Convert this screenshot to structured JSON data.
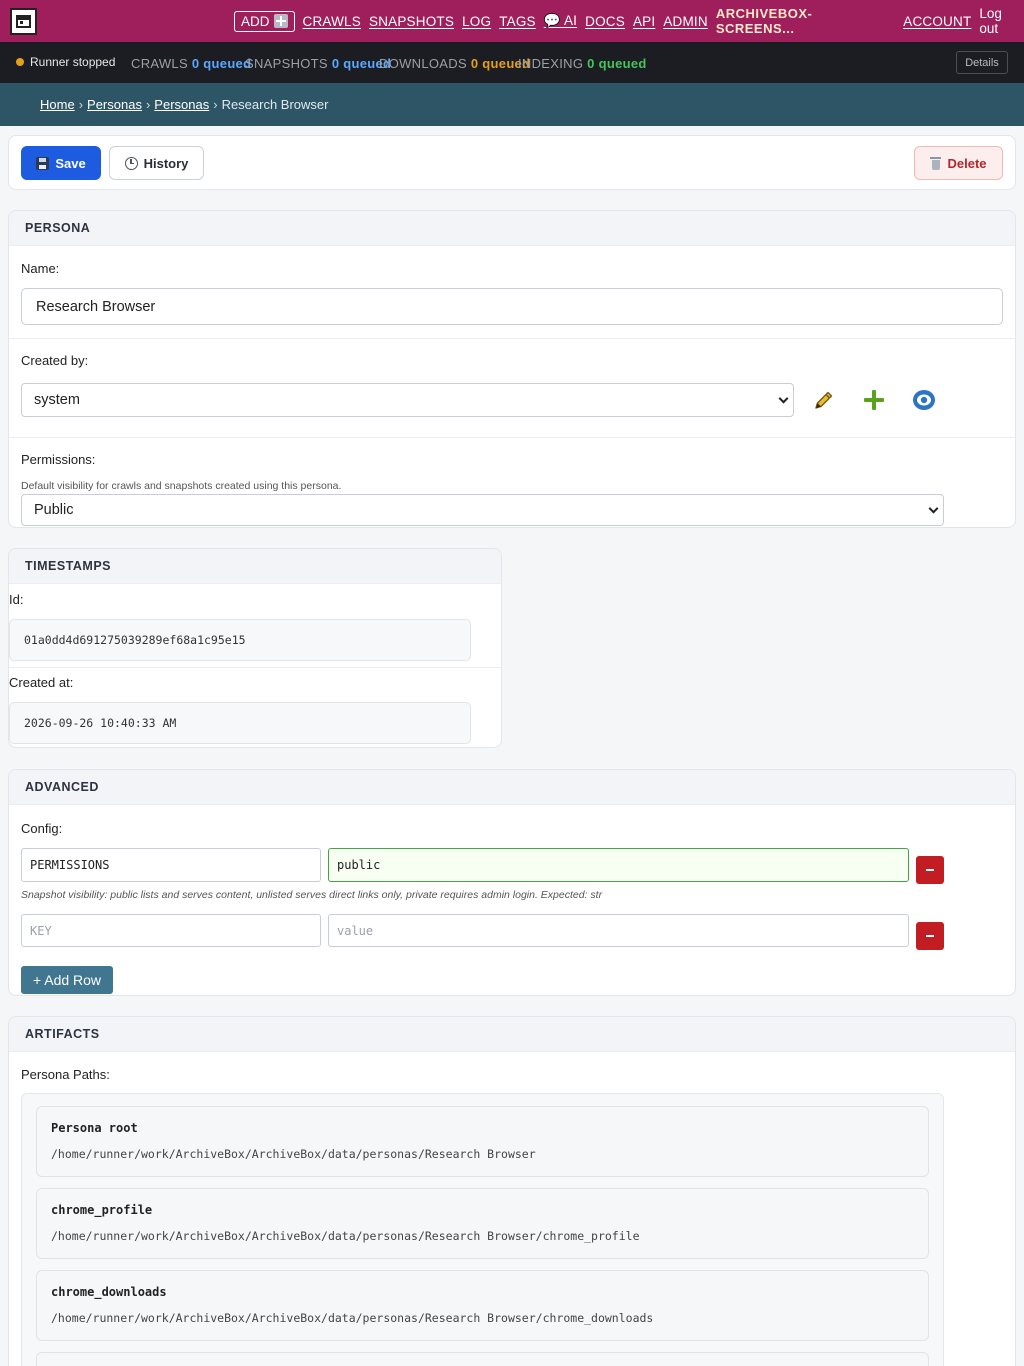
{
  "nav": {
    "add_label": "ADD",
    "links": [
      "CRAWLS",
      "SNAPSHOTS",
      "LOG",
      "TAGS",
      "💬 AI",
      "DOCS",
      "API",
      "ADMIN"
    ],
    "brand": "ARCHIVEBOX-SCREENS...",
    "account": "ACCOUNT",
    "logout": "Log out"
  },
  "status": {
    "runner": "Runner stopped",
    "crawls_label": "CRAWLS",
    "crawls_value": "0 queued",
    "snapshots_label": "SNAPSHOTS",
    "snapshots_value": "0 queued",
    "downloads_label": "DOWNLOADS",
    "downloads_value": "0 queued",
    "indexing_label": "INDEXING",
    "indexing_value": "0 queued",
    "details": "Details"
  },
  "breadcrumb": {
    "home": "Home",
    "personas_app": "Personas",
    "personas_model": "Personas",
    "current": "Research Browser",
    "sep": "›"
  },
  "toolbar": {
    "save": "Save",
    "history": "History",
    "delete": "Delete"
  },
  "persona": {
    "heading": "PERSONA",
    "name_label": "Name:",
    "name_value": "Research Browser",
    "created_by_label": "Created by:",
    "created_by_value": "system",
    "permissions_label": "Permissions:",
    "permissions_help": "Default visibility for crawls and snapshots created using this persona.",
    "permissions_value": "Public"
  },
  "timestamps": {
    "heading": "TIMESTAMPS",
    "id_label": "Id:",
    "id_value": "01a0dd4d691275039289ef68a1c95e15",
    "created_label": "Created at:",
    "created_value": "2026-09-26 10:40:33 AM"
  },
  "advanced": {
    "heading": "ADVANCED",
    "config_label": "Config:",
    "row1_key": "PERMISSIONS",
    "row1_value": "public",
    "row1_help": "Snapshot visibility: public lists and serves content, unlisted serves direct links only, private requires admin login. Expected: str",
    "key_placeholder": "KEY",
    "value_placeholder": "value",
    "add_row": "+ Add Row"
  },
  "artifacts": {
    "heading": "ARTIFACTS",
    "paths_label": "Persona Paths:",
    "paths": [
      {
        "name": "Persona root",
        "path": "/home/runner/work/ArchiveBox/ArchiveBox/data/personas/Research Browser"
      },
      {
        "name": "chrome_profile",
        "path": "/home/runner/work/ArchiveBox/ArchiveBox/data/personas/Research Browser/chrome_profile"
      },
      {
        "name": "chrome_downloads",
        "path": "/home/runner/work/ArchiveBox/ArchiveBox/data/personas/Research Browser/chrome_downloads"
      }
    ]
  },
  "colors": {
    "nav_bg": "#9e1f5c",
    "status_bg": "#1b1d22",
    "breadcrumb_bg": "#2d5566",
    "save_bg": "#1d5ce0",
    "delete_text": "#b3262b",
    "add_row_bg": "#417690"
  }
}
